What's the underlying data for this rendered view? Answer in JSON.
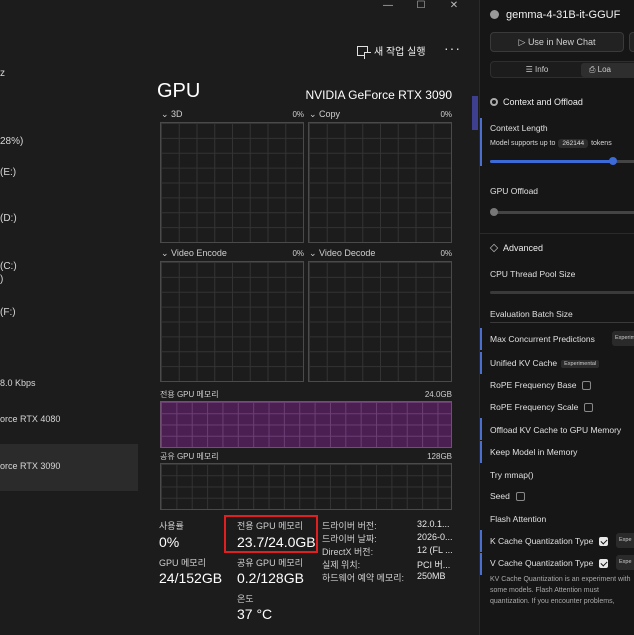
{
  "task_manager": {
    "window_controls": {
      "minimize": "—",
      "maximize": "☐",
      "close": "✕"
    },
    "toolbar": {
      "new_task_label": "새 작업 실행",
      "more_label": "···"
    },
    "devices": [
      {
        "line1": "z"
      },
      {
        "line1": "28%)"
      },
      {
        "line1": "(E:)"
      },
      {
        "line1": "(D:)"
      },
      {
        "line1": "(C:)",
        "line2": ")"
      },
      {
        "line1": "(F:)"
      },
      {
        "line1": "8.0 Kbps"
      },
      {
        "line1": "orce RTX 4080"
      },
      {
        "line1": "orce RTX 3090",
        "selected": true
      }
    ],
    "gpu_title": "GPU",
    "gpu_model": "NVIDIA GeForce RTX 3090",
    "graphs": [
      {
        "label": "3D",
        "pct": "0%"
      },
      {
        "label": "Copy",
        "pct": "0%"
      },
      {
        "label": "Video Encode",
        "pct": "0%"
      },
      {
        "label": "Video Decode",
        "pct": "0%"
      }
    ],
    "dedicated_graph": {
      "label": "전용 GPU 메모리",
      "max": "24.0GB",
      "fill": 0.99
    },
    "shared_graph": {
      "label": "공유 GPU 메모리",
      "max": "128GB"
    },
    "stats": {
      "usage_label": "사용률",
      "usage_value": "0%",
      "gpu_mem_label": "GPU 메모리",
      "gpu_mem_value": "24/152GB",
      "dedicated_label": "전용 GPU 메모리",
      "dedicated_value": "23.7/24.0GB",
      "shared_label": "공유 GPU 메모리",
      "shared_value": "0.2/128GB",
      "temp_label": "온도",
      "temp_value": "37 °C"
    },
    "info": [
      {
        "k": "드라이버 버전:",
        "v": "32.0.1..."
      },
      {
        "k": "드라이버 날짜:",
        "v": "2026-0..."
      },
      {
        "k": "DirectX 버전:",
        "v": "12 (FL ..."
      },
      {
        "k": "실제 위치:",
        "v": "PCI 버..."
      },
      {
        "k": "하드웨어 예약 메모리:",
        "v": "250MB"
      }
    ],
    "colors": {
      "highlight": "#e02020",
      "memory_fill": "#4b1f52"
    }
  },
  "lm_panel": {
    "title": "gemma-4-31B-it-GGUF",
    "use_chat_label": "▷ Use in New Chat",
    "tabs": {
      "info": "Info",
      "load": "Loa"
    },
    "context_section": "Context and Offload",
    "context_length_label": "Context Length",
    "model_supports_prefix": "Model supports up to",
    "token_count": "262144",
    "tokens_suffix": "tokens",
    "context_slider_value": 0.82,
    "gpu_offload_label": "GPU Offload",
    "gpu_offload_value": 0.0,
    "advanced_section": "Advanced",
    "cpu_thread_label": "CPU Thread Pool Size",
    "eval_batch_label": "Evaluation Batch Size",
    "max_concurrent_label": "Max Concurrent Predictions",
    "max_concurrent_stub": "Experim",
    "unified_kv_label": "Unified KV Cache",
    "experimental_badge": "Experimental",
    "rope_base_label": "RoPE Frequency Base",
    "rope_scale_label": "RoPE Frequency Scale",
    "offload_kv_label": "Offload KV Cache to GPU Memory",
    "keep_model_label": "Keep Model in Memory",
    "try_mmap_label": "Try mmap()",
    "seed_label": "Seed",
    "flash_attention_label": "Flash Attention",
    "k_cache_label": "K Cache Quantization Type",
    "v_cache_label": "V Cache Quantization Type",
    "exp_stub": "Expe",
    "note": "KV Cache Quantization is an experiment with some models. Flash Attention must quantization. If you encounter problems,",
    "colors": {
      "accent": "#3c6ad8"
    }
  }
}
